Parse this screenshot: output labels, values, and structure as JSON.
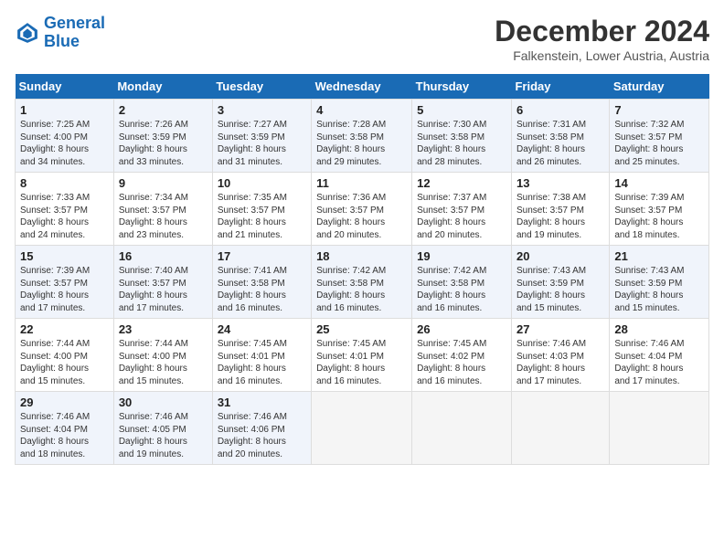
{
  "header": {
    "logo_line1": "General",
    "logo_line2": "Blue",
    "month": "December 2024",
    "location": "Falkenstein, Lower Austria, Austria"
  },
  "days_of_week": [
    "Sunday",
    "Monday",
    "Tuesday",
    "Wednesday",
    "Thursday",
    "Friday",
    "Saturday"
  ],
  "weeks": [
    [
      {
        "day": "1",
        "info": "Sunrise: 7:25 AM\nSunset: 4:00 PM\nDaylight: 8 hours\nand 34 minutes."
      },
      {
        "day": "2",
        "info": "Sunrise: 7:26 AM\nSunset: 3:59 PM\nDaylight: 8 hours\nand 33 minutes."
      },
      {
        "day": "3",
        "info": "Sunrise: 7:27 AM\nSunset: 3:59 PM\nDaylight: 8 hours\nand 31 minutes."
      },
      {
        "day": "4",
        "info": "Sunrise: 7:28 AM\nSunset: 3:58 PM\nDaylight: 8 hours\nand 29 minutes."
      },
      {
        "day": "5",
        "info": "Sunrise: 7:30 AM\nSunset: 3:58 PM\nDaylight: 8 hours\nand 28 minutes."
      },
      {
        "day": "6",
        "info": "Sunrise: 7:31 AM\nSunset: 3:58 PM\nDaylight: 8 hours\nand 26 minutes."
      },
      {
        "day": "7",
        "info": "Sunrise: 7:32 AM\nSunset: 3:57 PM\nDaylight: 8 hours\nand 25 minutes."
      }
    ],
    [
      {
        "day": "8",
        "info": "Sunrise: 7:33 AM\nSunset: 3:57 PM\nDaylight: 8 hours\nand 24 minutes."
      },
      {
        "day": "9",
        "info": "Sunrise: 7:34 AM\nSunset: 3:57 PM\nDaylight: 8 hours\nand 23 minutes."
      },
      {
        "day": "10",
        "info": "Sunrise: 7:35 AM\nSunset: 3:57 PM\nDaylight: 8 hours\nand 21 minutes."
      },
      {
        "day": "11",
        "info": "Sunrise: 7:36 AM\nSunset: 3:57 PM\nDaylight: 8 hours\nand 20 minutes."
      },
      {
        "day": "12",
        "info": "Sunrise: 7:37 AM\nSunset: 3:57 PM\nDaylight: 8 hours\nand 20 minutes."
      },
      {
        "day": "13",
        "info": "Sunrise: 7:38 AM\nSunset: 3:57 PM\nDaylight: 8 hours\nand 19 minutes."
      },
      {
        "day": "14",
        "info": "Sunrise: 7:39 AM\nSunset: 3:57 PM\nDaylight: 8 hours\nand 18 minutes."
      }
    ],
    [
      {
        "day": "15",
        "info": "Sunrise: 7:39 AM\nSunset: 3:57 PM\nDaylight: 8 hours\nand 17 minutes."
      },
      {
        "day": "16",
        "info": "Sunrise: 7:40 AM\nSunset: 3:57 PM\nDaylight: 8 hours\nand 17 minutes."
      },
      {
        "day": "17",
        "info": "Sunrise: 7:41 AM\nSunset: 3:58 PM\nDaylight: 8 hours\nand 16 minutes."
      },
      {
        "day": "18",
        "info": "Sunrise: 7:42 AM\nSunset: 3:58 PM\nDaylight: 8 hours\nand 16 minutes."
      },
      {
        "day": "19",
        "info": "Sunrise: 7:42 AM\nSunset: 3:58 PM\nDaylight: 8 hours\nand 16 minutes."
      },
      {
        "day": "20",
        "info": "Sunrise: 7:43 AM\nSunset: 3:59 PM\nDaylight: 8 hours\nand 15 minutes."
      },
      {
        "day": "21",
        "info": "Sunrise: 7:43 AM\nSunset: 3:59 PM\nDaylight: 8 hours\nand 15 minutes."
      }
    ],
    [
      {
        "day": "22",
        "info": "Sunrise: 7:44 AM\nSunset: 4:00 PM\nDaylight: 8 hours\nand 15 minutes."
      },
      {
        "day": "23",
        "info": "Sunrise: 7:44 AM\nSunset: 4:00 PM\nDaylight: 8 hours\nand 15 minutes."
      },
      {
        "day": "24",
        "info": "Sunrise: 7:45 AM\nSunset: 4:01 PM\nDaylight: 8 hours\nand 16 minutes."
      },
      {
        "day": "25",
        "info": "Sunrise: 7:45 AM\nSunset: 4:01 PM\nDaylight: 8 hours\nand 16 minutes."
      },
      {
        "day": "26",
        "info": "Sunrise: 7:45 AM\nSunset: 4:02 PM\nDaylight: 8 hours\nand 16 minutes."
      },
      {
        "day": "27",
        "info": "Sunrise: 7:46 AM\nSunset: 4:03 PM\nDaylight: 8 hours\nand 17 minutes."
      },
      {
        "day": "28",
        "info": "Sunrise: 7:46 AM\nSunset: 4:04 PM\nDaylight: 8 hours\nand 17 minutes."
      }
    ],
    [
      {
        "day": "29",
        "info": "Sunrise: 7:46 AM\nSunset: 4:04 PM\nDaylight: 8 hours\nand 18 minutes."
      },
      {
        "day": "30",
        "info": "Sunrise: 7:46 AM\nSunset: 4:05 PM\nDaylight: 8 hours\nand 19 minutes."
      },
      {
        "day": "31",
        "info": "Sunrise: 7:46 AM\nSunset: 4:06 PM\nDaylight: 8 hours\nand 20 minutes."
      },
      null,
      null,
      null,
      null
    ]
  ]
}
